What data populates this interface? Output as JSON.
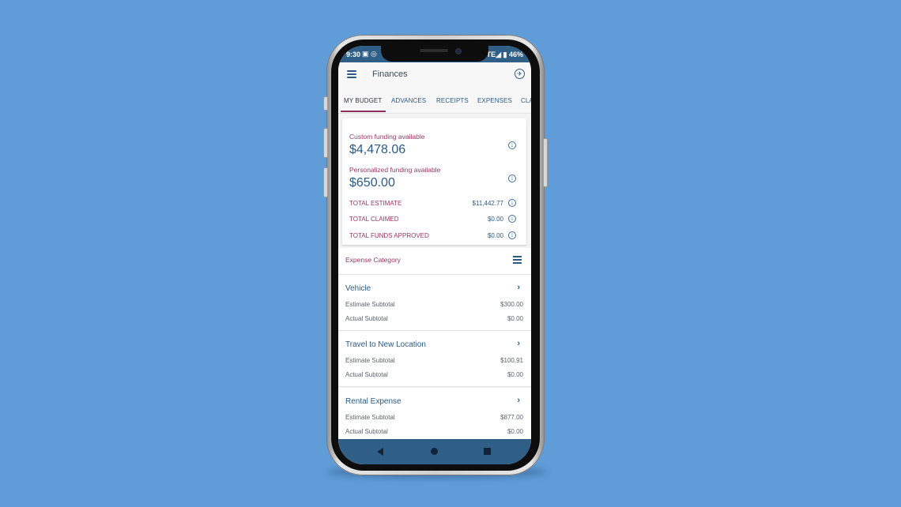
{
  "status_bar": {
    "time": "9:30",
    "left_icons": "▣ ◎",
    "right_text": "TE◢ ▮ 46%"
  },
  "app_bar": {
    "title": "Finances",
    "menu_icon": "hamburger-menu-icon",
    "right_icon": "airplane-circle-icon"
  },
  "tabs": [
    {
      "label": "MY BUDGET",
      "active": true
    },
    {
      "label": "ADVANCES",
      "active": false
    },
    {
      "label": "RECEIPTS",
      "active": false
    },
    {
      "label": "EXPENSES",
      "active": false
    },
    {
      "label": "CLA",
      "active": false
    }
  ],
  "funding": {
    "custom_label": "Custom funding available",
    "custom_amount": "$4,478.06",
    "personalized_label": "Personalized funding available",
    "personalized_amount": "$650.00",
    "totals": [
      {
        "label": "TOTAL ESTIMATE",
        "value": "$11,442.77"
      },
      {
        "label": "TOTAL CLAIMED",
        "value": "$0.00"
      },
      {
        "label": "TOTAL FUNDS APPROVED",
        "value": "$0.00"
      }
    ]
  },
  "section": {
    "label": "Expense Category",
    "icon": "filter-sliders-icon"
  },
  "categories": [
    {
      "title": "Vehicle",
      "estimate_label": "Estimate Subtotal",
      "estimate": "$300.00",
      "actual_label": "Actual Subtotal",
      "actual": "$0.00"
    },
    {
      "title": "Travel to New Location",
      "estimate_label": "Estimate Subtotal",
      "estimate": "$100.91",
      "actual_label": "Actual Subtotal",
      "actual": "$0.00"
    },
    {
      "title": "Rental Expense",
      "estimate_label": "Estimate Subtotal",
      "estimate": "$877.00",
      "actual_label": "Actual Subtotal",
      "actual": "$0.00"
    }
  ],
  "colors": {
    "background": "#5f9cd8",
    "brand_blue": "#2c5a84",
    "accent_magenta": "#9a3664",
    "nav_bar": "#2f5f87"
  }
}
